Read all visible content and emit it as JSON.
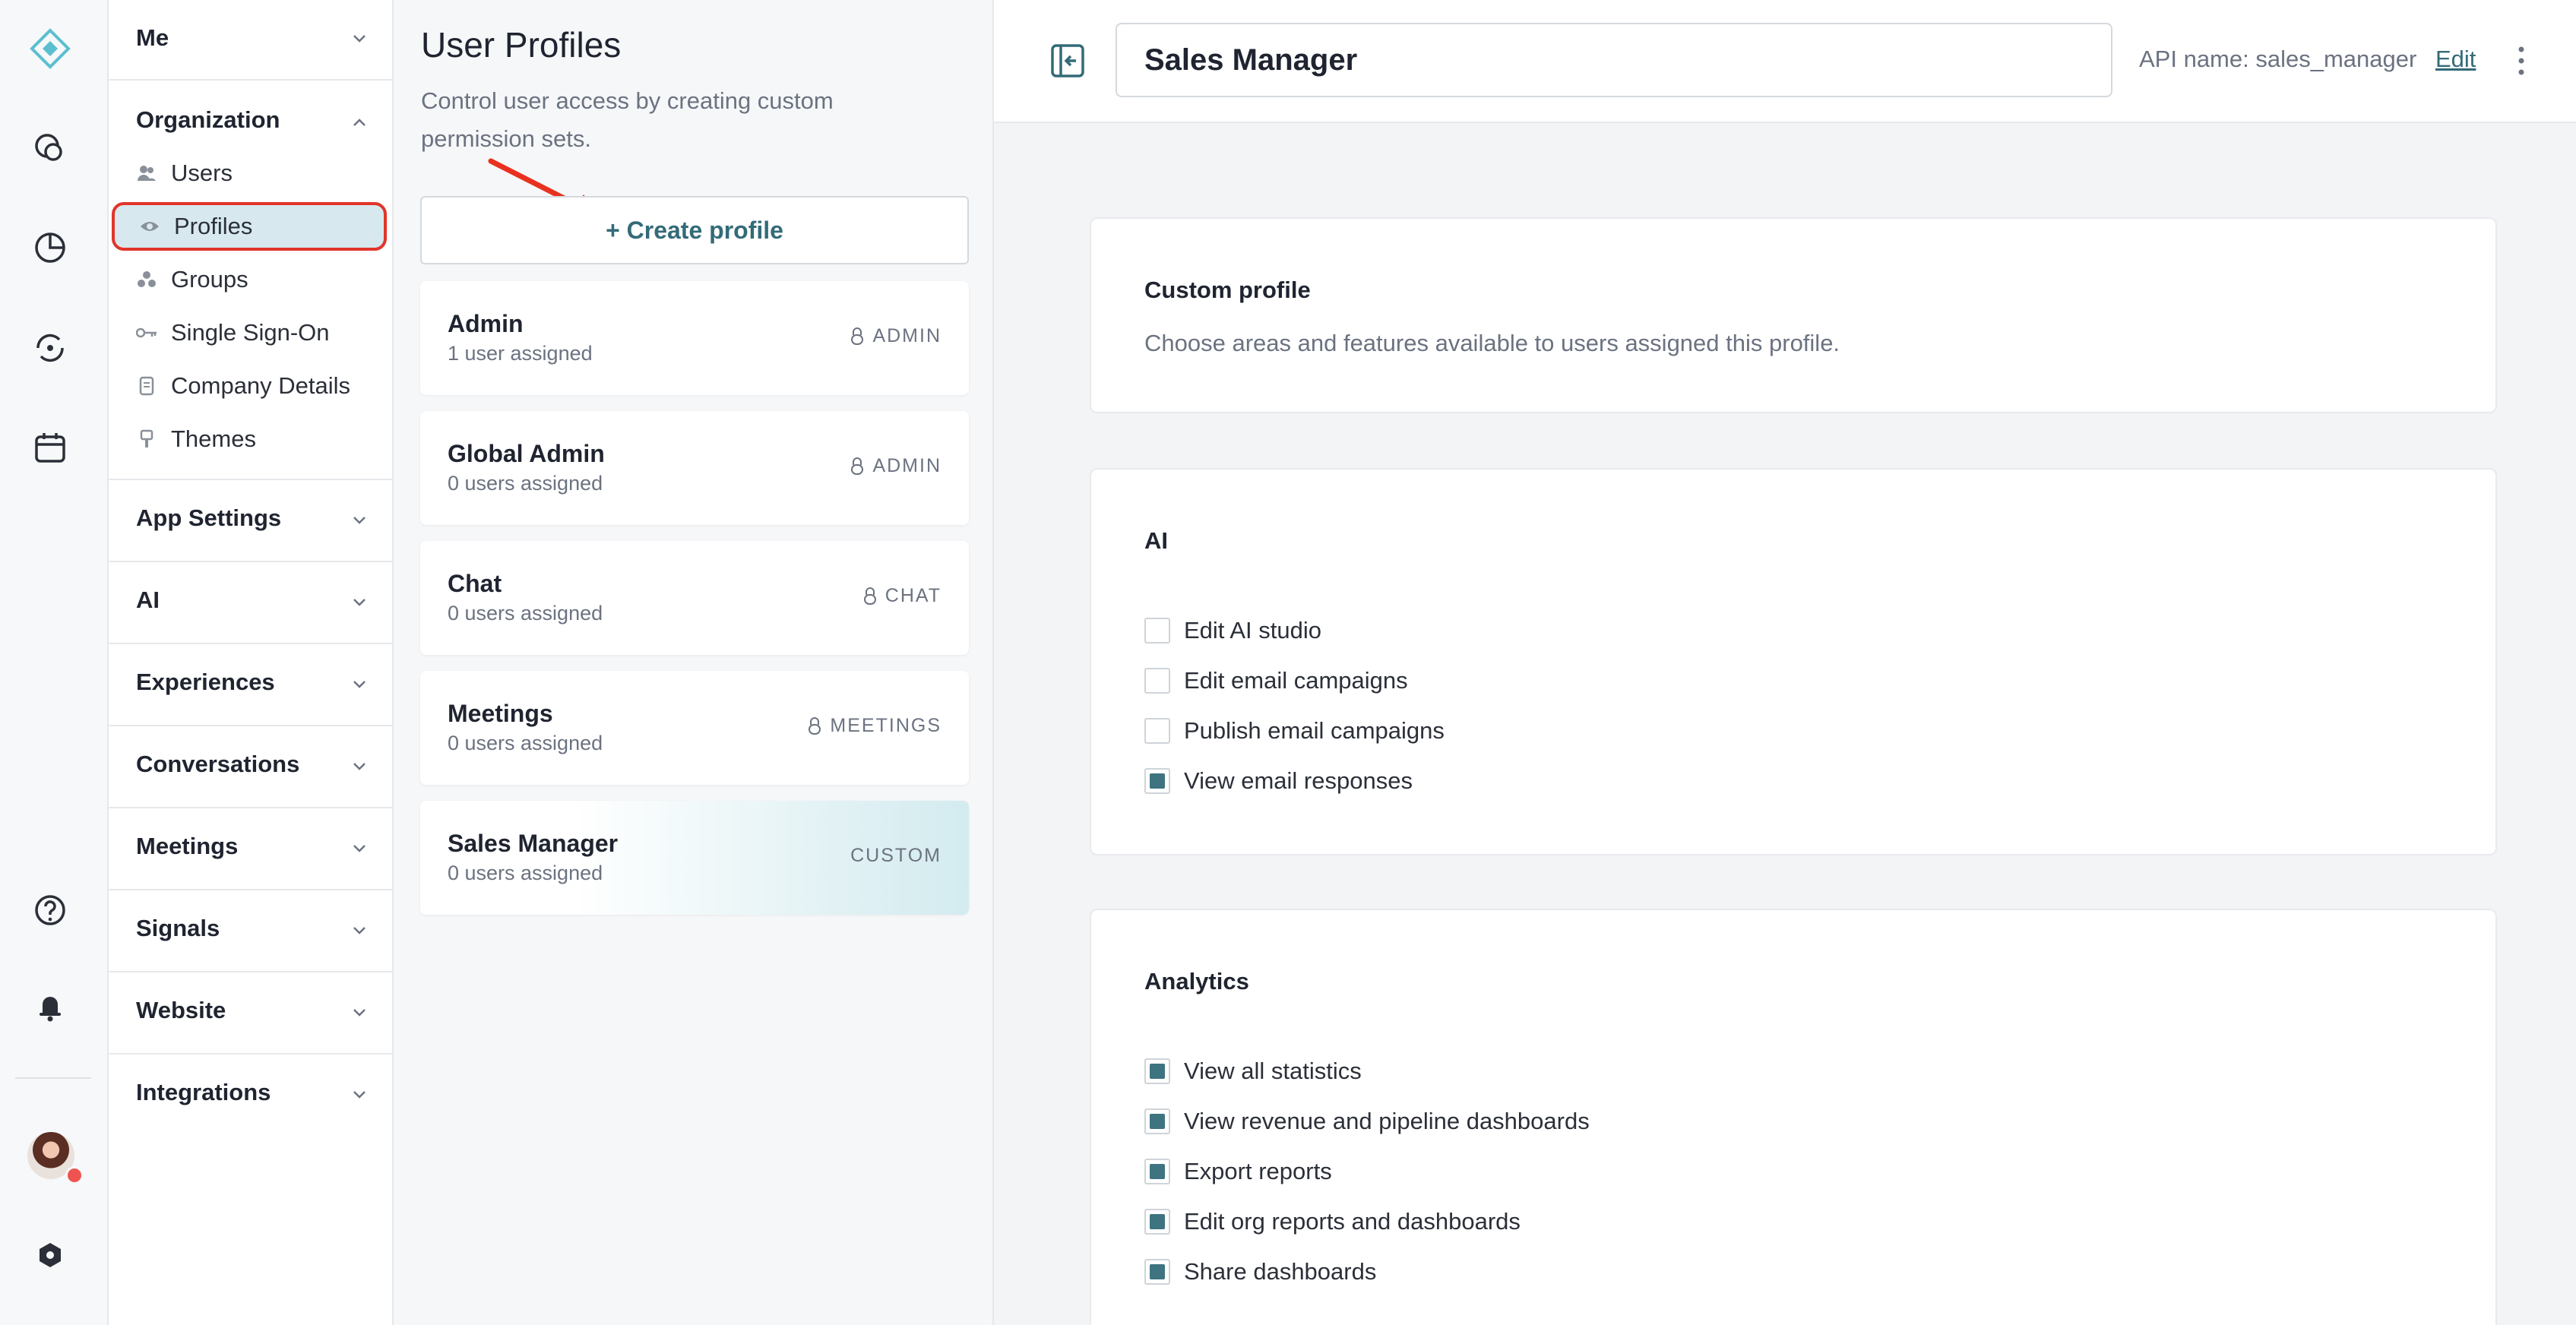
{
  "sidebar": {
    "me": "Me",
    "organization": "Organization",
    "org_items": [
      {
        "label": "Users",
        "icon": "users-icon"
      },
      {
        "label": "Profiles",
        "icon": "eye-icon"
      },
      {
        "label": "Groups",
        "icon": "groups-icon"
      },
      {
        "label": "Single Sign-On",
        "icon": "key-icon"
      },
      {
        "label": "Company Details",
        "icon": "document-icon"
      },
      {
        "label": "Themes",
        "icon": "brush-icon"
      }
    ],
    "sections": [
      "App Settings",
      "AI",
      "Experiences",
      "Conversations",
      "Meetings",
      "Signals",
      "Website",
      "Integrations"
    ]
  },
  "profiles": {
    "title": "User Profiles",
    "description": "Control user access by creating custom permission sets.",
    "create_label": "+ Create profile",
    "items": [
      {
        "name": "Admin",
        "count": "1 user assigned",
        "tag": "ADMIN"
      },
      {
        "name": "Global Admin",
        "count": "0 users assigned",
        "tag": "ADMIN"
      },
      {
        "name": "Chat",
        "count": "0 users assigned",
        "tag": "CHAT"
      },
      {
        "name": "Meetings",
        "count": "0 users assigned",
        "tag": "MEETINGS"
      },
      {
        "name": "Sales Manager",
        "count": "0 users assigned",
        "tag": "CUSTOM"
      }
    ]
  },
  "detail": {
    "profile_name": "Sales Manager",
    "api_name": "API name: sales_manager",
    "edit_label": "Edit",
    "custom_title": "Custom profile",
    "custom_desc": "Choose areas and features available to users assigned this profile.",
    "ai": {
      "title": "AI",
      "items": [
        {
          "label": "Edit AI studio",
          "checked": false
        },
        {
          "label": "Edit email campaigns",
          "checked": false
        },
        {
          "label": "Publish email campaigns",
          "checked": false
        },
        {
          "label": "View email responses",
          "checked": true
        }
      ]
    },
    "analytics": {
      "title": "Analytics",
      "items": [
        {
          "label": "View all statistics",
          "checked": true
        },
        {
          "label": "View revenue and pipeline dashboards",
          "checked": true
        },
        {
          "label": "Export reports",
          "checked": true
        },
        {
          "label": "Edit org reports and dashboards",
          "checked": true
        },
        {
          "label": "Share dashboards",
          "checked": true
        }
      ]
    }
  },
  "colors": {
    "accent": "#336b78",
    "checkbox_fill": "#3d7480",
    "highlight_border": "#e2352a",
    "arrow": "#e8321f"
  }
}
